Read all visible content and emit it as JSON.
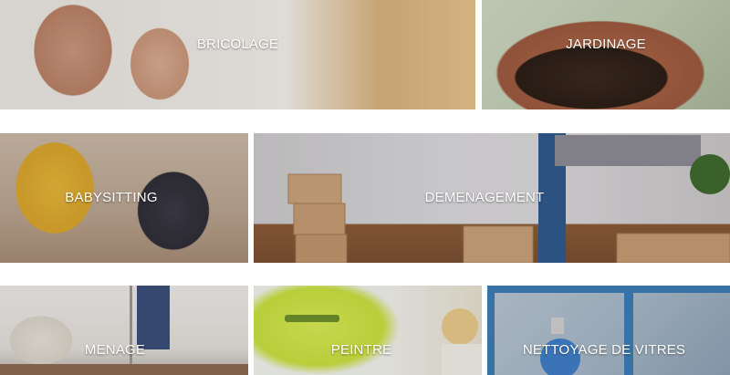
{
  "services": [
    {
      "id": "bricolage",
      "label": "BRICOLAGE",
      "icon": "photo-couple-drilling"
    },
    {
      "id": "jardinage",
      "label": "JARDINAGE",
      "icon": "photo-potted-plant"
    },
    {
      "id": "babysitting",
      "label": "BABYSITTING",
      "icon": "photo-woman-and-child-crafting"
    },
    {
      "id": "demenagement",
      "label": "DEMENAGEMENT",
      "icon": "photo-moving-boxes"
    },
    {
      "id": "menage",
      "label": "MENAGE",
      "icon": "photo-cleaning-room"
    },
    {
      "id": "peintre",
      "label": "PEINTRE",
      "icon": "photo-painting-wall"
    },
    {
      "id": "vitres",
      "label": "NETTOYAGE DE VITRES",
      "icon": "photo-window-cleaning"
    }
  ],
  "colors": {
    "label_text": "#ffffff",
    "page_background": "#ffffff"
  }
}
